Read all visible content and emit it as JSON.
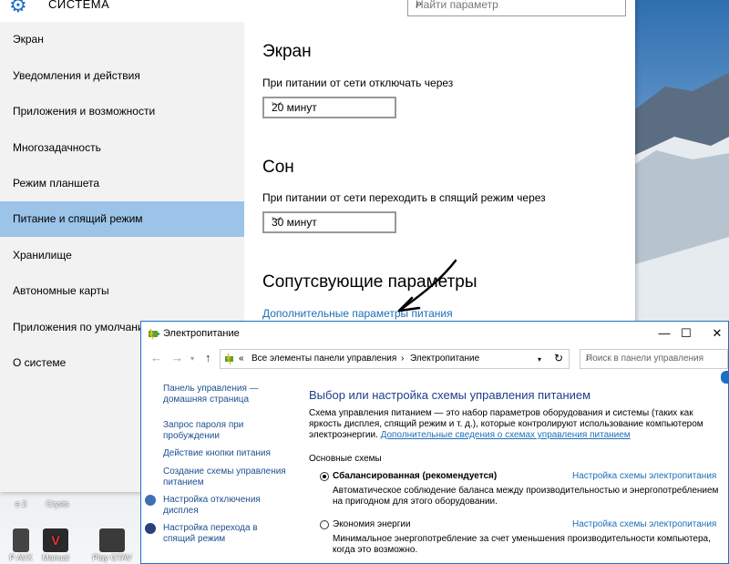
{
  "settings": {
    "title": "СИСТЕМА",
    "search_placeholder": "Найти параметр",
    "nav": [
      "Экран",
      "Уведомления и действия",
      "Приложения и возможности",
      "Многозадачность",
      "Режим планшета",
      "Питание и спящий режим",
      "Хранилище",
      "Автономные карты",
      "Приложения по умолчанию",
      "О системе"
    ],
    "active_index": 5,
    "screen_heading": "Экран",
    "screen_label": "При питании от сети отключать через",
    "screen_value": "20 минут",
    "sleep_heading": "Сон",
    "sleep_label": "При питании от сети переходить в спящий режим через",
    "sleep_value": "30 минут",
    "related_heading": "Сопутсвующие параметры",
    "related_link": "Дополнительные параметры питания"
  },
  "power": {
    "title": "Электропитание",
    "btn_min": "—",
    "btn_max": "☐",
    "btn_close": "✕",
    "breadcrumb_root": "«",
    "breadcrumb_1": "Все элементы панели управления",
    "breadcrumb_sep": "›",
    "breadcrumb_2": "Электропитание",
    "search_placeholder": "Поиск в панели управления",
    "left_links": [
      "Панель управления — домашняя страница",
      "Запрос пароля при пробуждении",
      "Действие кнопки питания",
      "Создание схемы управления питанием",
      "Настройка отключения дисплея",
      "Настройка перехода в спящий режим"
    ],
    "heading": "Выбор или настройка схемы управления питанием",
    "desc": "Схема управления питанием — это набор параметров оборудования и системы (таких как яркость дисплея, спящий режим и т. д.), которые контролируют использование компьютером электроэнергии.",
    "desc_link": "Дополнительные сведения о схемах управления питанием",
    "group_label": "Основные схемы",
    "schemes": [
      {
        "name": "Сбалансированная (рекомендуется)",
        "link": "Настройка схемы электропитания",
        "desc": "Автоматическое соблюдение баланса между производительностью и энергопотреблением на пригодном для этого оборудовании.",
        "selected": true
      },
      {
        "name": "Экономия энергии",
        "link": "Настройка схемы электропитания",
        "desc": "Минимальное энергопотребление за счет уменьшения производительности компьютера, когда это возможно.",
        "selected": false
      }
    ]
  },
  "desktop": {
    "icons": [
      "e 2",
      "Crysis",
      "P AVX",
      "Manual",
      "Play GTAV"
    ]
  },
  "colors": {
    "accent": "#1c6fc4",
    "nav_active": "#9cc3e8",
    "link": "#1e6fb8"
  }
}
